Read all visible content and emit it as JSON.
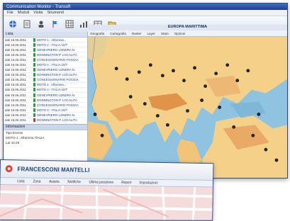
{
  "window1": {
    "title": "Communication Monitor - Transoft",
    "menu": [
      "File",
      "Moduli",
      "Visita",
      "Strumenti"
    ],
    "toolbar": [
      {
        "icon": "globe-icon"
      },
      {
        "icon": "document-icon"
      },
      {
        "icon": "person-icon"
      },
      {
        "icon": "flag-icon"
      },
      {
        "icon": "grid-icon"
      },
      {
        "icon": "chart-icon"
      },
      {
        "icon": "table-icon"
      },
      {
        "icon": "folder-icon"
      }
    ],
    "left_panel_header": "Lista",
    "events": [
      {
        "time": "dati 15.06.2011",
        "label": "MOTO 1 : Alfaroma...",
        "color": "#2e9d3a"
      },
      {
        "time": "dati 15.06.2011",
        "label": "MOTO 2 : ITALIA 10/T",
        "color": "#2e9d3a"
      },
      {
        "time": "dati 15.06.2011",
        "label": "GENEVRIERO LONDRA N.",
        "color": "#2e9d3a"
      },
      {
        "time": "dati 15.06.2011",
        "label": "DONNINGTON P. LOCALITA",
        "color": "#2e9d3a"
      },
      {
        "time": "dati 15.06.2011",
        "label": "CONCESSIONARIO FOGGIA",
        "color": "#2e9d3a"
      },
      {
        "time": "dati 15.06.2011",
        "label": "MOTO 4 : ITALIA 10/T",
        "color": "#2e9d3a"
      },
      {
        "time": "dati 15.06.2011",
        "label": "GENEVRIERO LONDRA N.",
        "color": "#2e9d3a"
      },
      {
        "time": "dati 15.06.2011",
        "label": "DONNINGTON P. LOCALITA",
        "color": "#2e9d3a"
      },
      {
        "time": "dati 15.06.2011",
        "label": "CONCESSIONARIO FOGGIA",
        "color": "#2e9d3a"
      },
      {
        "time": "dati 15.06.2011",
        "label": "MOTO 1 : Alfaroma...",
        "color": "#2e9d3a"
      },
      {
        "time": "dati 15.06.2011",
        "label": "MOTO 2 : ITALIA 10/T",
        "color": "#2e9d3a"
      },
      {
        "time": "dati 15.06.2011",
        "label": "GENEVRIERO LONDRA N.",
        "color": "#2e9d3a"
      },
      {
        "time": "dati 15.06.2011",
        "label": "DONNINGTON P. LOCALITA",
        "color": "#2e9d3a"
      },
      {
        "time": "dati 15.06.2011",
        "label": "CONCESSIONARIO FOGGIA",
        "color": "#2e9d3a"
      },
      {
        "time": "dati 15.06.2011",
        "label": "MOTO 3 : ITALIA 10/T",
        "color": "#2e9d3a"
      },
      {
        "time": "dati 15.06.2011",
        "label": "GENEVRIERO LONDRA N.",
        "color": "#2e9d3a"
      },
      {
        "time": "dati 15.06.2011",
        "label": "DONNINGTON P. LOCALITA",
        "color": "#d93030"
      },
      {
        "time": "dati 15.06.2011",
        "label": "CONCESSIONARIO FOGGIA",
        "color": "#d93030"
      },
      {
        "time": "dati 15.06.2011",
        "label": "GENEVRIERO LONDRA N.",
        "color": "#d93030"
      }
    ],
    "detail_header": "Informazioni",
    "detail_lines": [
      "Tipo Evento",
      "MOTO 1 : Alfaroma ITALIA",
      "Lat 44.29"
    ],
    "map_title": "EUROPA MARITTIMA",
    "map_tabs": [
      "Geografia",
      "Cartografia",
      "Raster",
      "Layer",
      "Stato",
      "Opzioni"
    ]
  },
  "window2": {
    "title": "FRANCESCONI MANTELLI",
    "tabs": [
      "Lista",
      "Zona",
      "Assets",
      "Notifiche",
      "Ultima posizione",
      "Report",
      "Impostazioni"
    ]
  }
}
